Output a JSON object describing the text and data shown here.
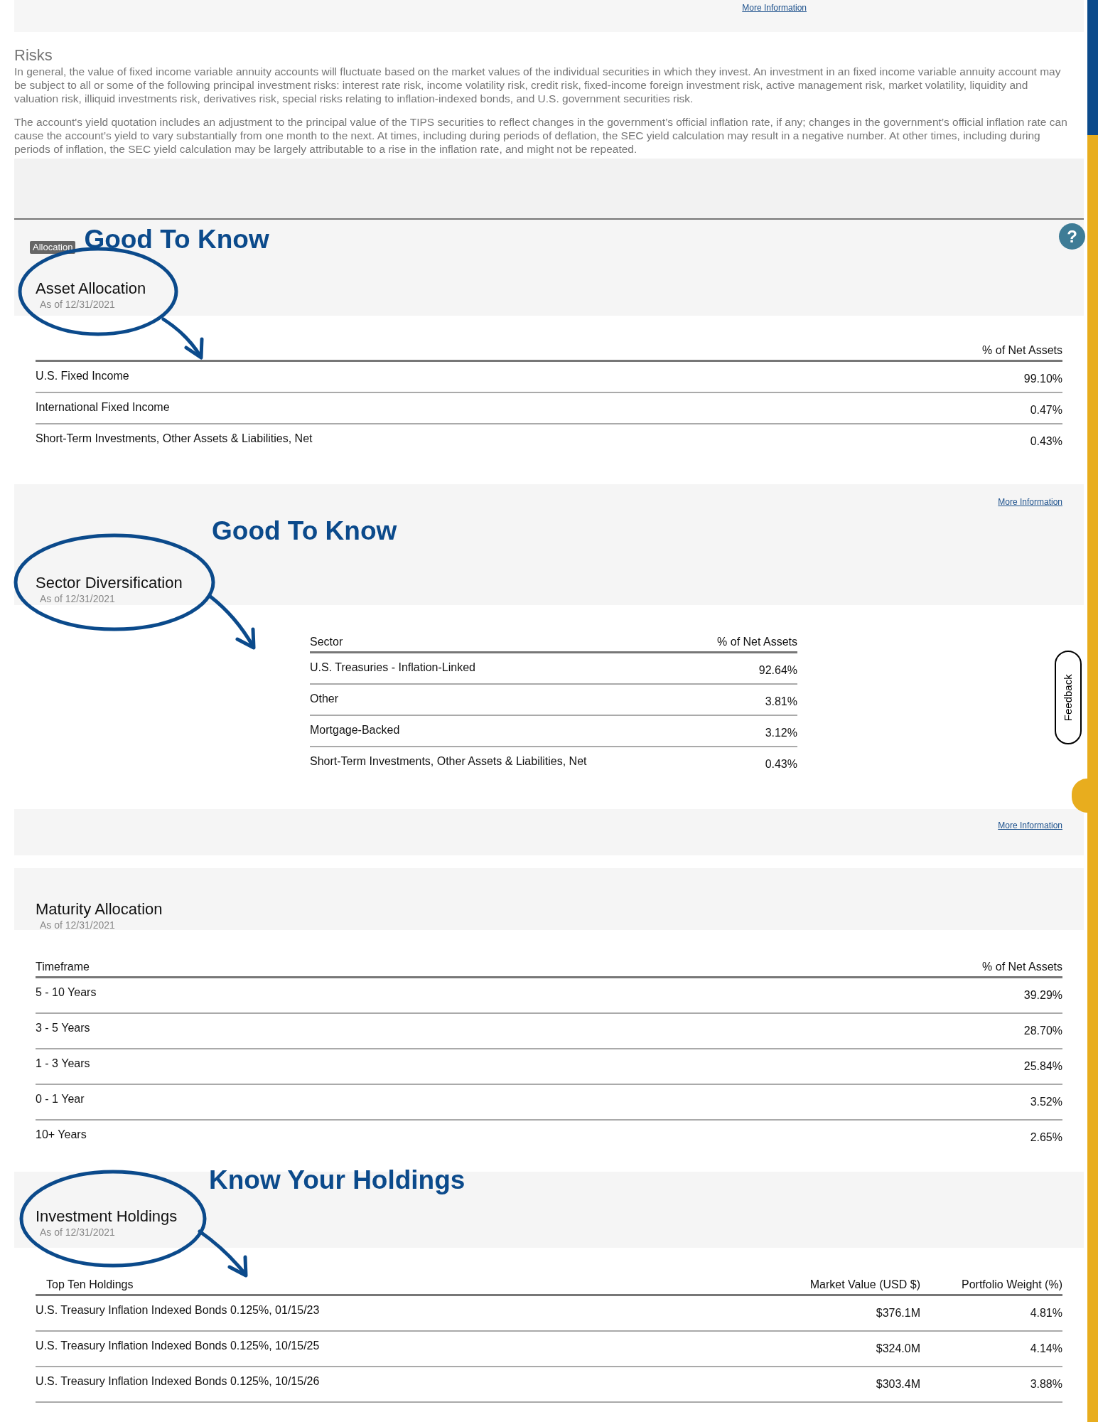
{
  "top_panel": {
    "link": "More Information"
  },
  "risks": {
    "title": "Risks",
    "paragraphs": [
      "In general, the value of fixed income variable annuity accounts will fluctuate based on the market values of the individual securities in which they invest. An investment in an fixed income variable annuity account may be subject to all or some of the following principal investment risks: interest rate risk, income volatility risk, credit risk, fixed-income foreign investment risk, active management risk, market volatility, liquidity and valuation risk, illiquid investments risk, derivatives risk, special risks relating to inflation-indexed bonds, and U.S. government securities risk.",
      "The account's yield quotation includes an adjustment to the principal value of the TIPS securities to reflect changes in the government’s official inflation rate, if any; changes in the government’s official inflation rate can cause the account’s yield to vary substantially from one month to the next. At times, including during periods of deflation, the SEC yield calculation may result in a negative number. At other times, including during periods of inflation, the SEC yield calculation may be largely attributable to a rise in the inflation rate, and might not be repeated."
    ]
  },
  "help_button": "?",
  "feedback": "Feedback",
  "sections": [
    {
      "kind": "full",
      "tag": "Allocation",
      "annotation": "Good To Know",
      "title": "Asset Allocation",
      "date": "As of 12/31/2021",
      "columns": [
        "",
        "% of Net Assets"
      ],
      "link": "More Information",
      "rows": [
        {
          "cells": [
            "U.S. Fixed Income",
            "99.10%"
          ]
        },
        {
          "cells": [
            "International Fixed Income",
            "0.47%"
          ]
        },
        {
          "cells": [
            "Short-Term Investments, Other Assets & Liabilities, Net",
            "0.43%"
          ]
        }
      ]
    },
    {
      "kind": "centered",
      "annotation": "Good To Know",
      "title": "Sector Diversification",
      "date": "As of 12/31/2021",
      "columns": [
        "Sector",
        "% of Net Assets"
      ],
      "link": "More Information",
      "rows": [
        {
          "cells": [
            "U.S. Treasuries - Inflation-Linked",
            "92.64%"
          ]
        },
        {
          "cells": [
            "Other",
            "3.81%"
          ]
        },
        {
          "cells": [
            "Mortgage-Backed",
            "3.12%"
          ]
        },
        {
          "cells": [
            "Short-Term Investments, Other Assets & Liabilities, Net",
            "0.43%"
          ]
        }
      ]
    },
    {
      "kind": "full",
      "title": "Maturity Allocation",
      "date": "As of 12/31/2021",
      "columns": [
        "Timeframe",
        "% of Net Assets"
      ],
      "rows": [
        {
          "cells": [
            "5 - 10 Years",
            "39.29%"
          ]
        },
        {
          "cells": [
            "3 - 5 Years",
            "28.70%"
          ]
        },
        {
          "cells": [
            "1 - 3 Years",
            "25.84%"
          ]
        },
        {
          "cells": [
            "0 - 1 Year",
            "3.52%"
          ]
        },
        {
          "cells": [
            "10+ Years",
            "2.65%"
          ]
        }
      ]
    },
    {
      "kind": "holdings",
      "annotation": "Know Your Holdings",
      "title": "Investment Holdings",
      "date": "As of 12/31/2021",
      "columns": [
        "Top Ten Holdings",
        "Market Value (USD $)",
        "Portfolio Weight (%)"
      ],
      "rows": [
        {
          "cells": [
            "U.S. Treasury Inflation Indexed Bonds 0.125%, 01/15/23",
            "$376.1M",
            "4.81%"
          ]
        },
        {
          "cells": [
            "U.S. Treasury Inflation Indexed Bonds 0.125%, 10/15/25",
            "$324.0M",
            "4.14%"
          ]
        },
        {
          "cells": [
            "U.S. Treasury Inflation Indexed Bonds 0.125%, 10/15/26",
            "$303.4M",
            "3.88%"
          ]
        }
      ]
    }
  ]
}
